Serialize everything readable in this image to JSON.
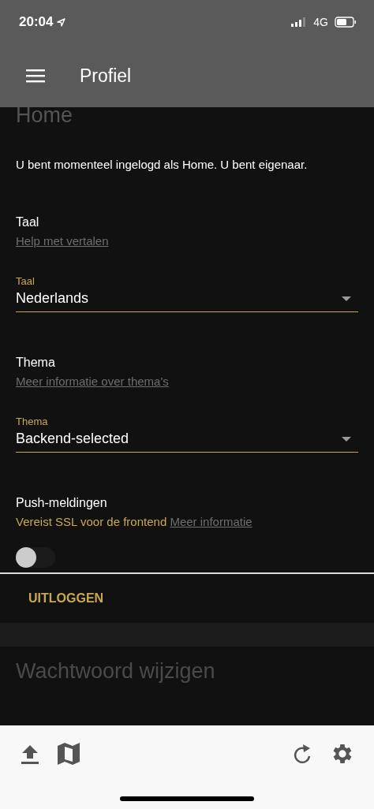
{
  "status_bar": {
    "time": "20:04",
    "network": "4G"
  },
  "app_bar": {
    "title": "Profiel"
  },
  "profile_card": {
    "heading": "Home",
    "intro": "U bent momenteel ingelogd als Home. U bent eigenaar.",
    "settings": [
      {
        "kind": "select",
        "title": "Taal",
        "link": "Help met vertalen",
        "label": "Taal",
        "value": "Nederlands"
      },
      {
        "kind": "select",
        "title": "Thema",
        "link": "Meer informatie over thema's",
        "label": "Thema",
        "value": "Backend-selected"
      },
      {
        "kind": "toggle",
        "title": "Push-meldingen",
        "note": "Vereist SSL voor de frontend",
        "link": "Meer informatie",
        "on": false
      }
    ],
    "logout_button": "UITLOGGEN"
  },
  "password_card": {
    "title": "Wachtwoord wijzigen"
  }
}
